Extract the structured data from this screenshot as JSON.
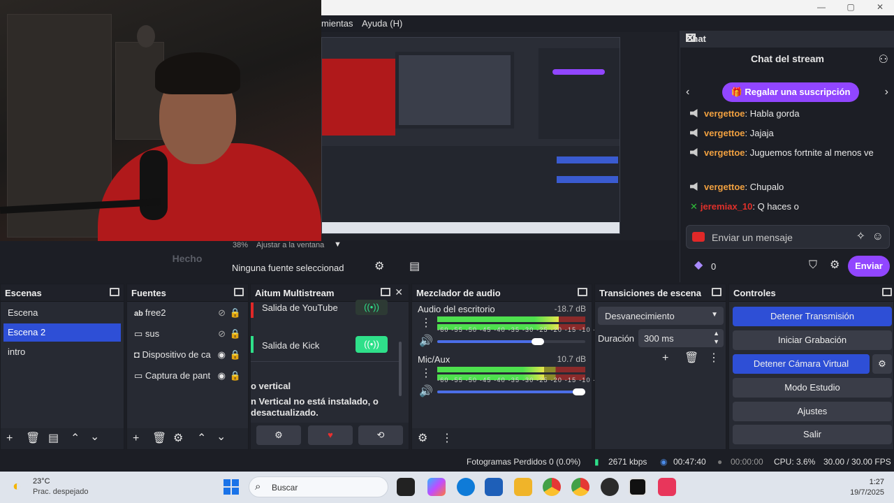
{
  "menu": {
    "tools_partial": "mientas",
    "help": "Ayuda (H)"
  },
  "window_controls": {
    "minimize": "—",
    "maximize": "▢",
    "close": "✕"
  },
  "preview": {
    "zoom": "38%",
    "fit_label": "Ajustar a la ventana"
  },
  "done_button": "Hecho",
  "no_source": "Ninguna fuente seleccionad",
  "chat": {
    "dock_title": "Chat",
    "title": "Chat del stream",
    "gift_button": "Regalar una suscripción",
    "messages": [
      {
        "user": "vergettoe",
        "text": ": Habla gorda"
      },
      {
        "user": "vergettoe",
        "text": ": Jajaja"
      },
      {
        "user": "vergettoe",
        "text": ": Juguemos fortnite al menos ve"
      },
      {
        "user": "vergettoe",
        "text": ": Chupalo"
      },
      {
        "user": "jeremiax_10",
        "text": ": Q haces o"
      }
    ],
    "input_placeholder": "Enviar un mensaje",
    "points": "0",
    "send_button": "Enviar"
  },
  "scenes": {
    "title": "Escenas",
    "items": [
      "Escena",
      "Escena 2",
      "intro"
    ],
    "selected_index": 1
  },
  "sources": {
    "title": "Fuentes",
    "items": [
      {
        "label": "free2",
        "icon": "text-icon"
      },
      {
        "label": "sus",
        "icon": "window-icon"
      },
      {
        "label": "Dispositivo de ca",
        "icon": "camera-icon"
      },
      {
        "label": "Captura de pant",
        "icon": "monitor-icon"
      }
    ]
  },
  "multistream": {
    "title": "Aitum Multistream",
    "outputs": [
      "Salida de YouTube",
      "Salida de Kick"
    ],
    "vertical_heading": "o vertical",
    "vertical_note_1": "n Vertical no está instalado, o",
    "vertical_note_2": "desactualizado."
  },
  "mixer": {
    "title": "Mezclador de audio",
    "ticks": "-60 -55 -50 -45 -40 -35 -30 -25 -20 -15 -10 -5 0",
    "channels": [
      {
        "name": "Audio del escritorio",
        "db": "-18.7 dB",
        "level": 0.82,
        "volume": 0.72
      },
      {
        "name": "Mic/Aux",
        "db": "10.7 dB",
        "level": 0.72,
        "volume": 1.0
      }
    ]
  },
  "transitions": {
    "title": "Transiciones de escena",
    "selected": "Desvanecimiento",
    "duration_label": "Duración",
    "duration_value": "300 ms"
  },
  "controls": {
    "title": "Controles",
    "buttons": [
      "Detener Transmisión",
      "Iniciar Grabación",
      "Detener Cámara Virtual",
      "Modo Estudio",
      "Ajustes",
      "Salir"
    ]
  },
  "status": {
    "dropped": "Fotogramas Perdidos 0 (0.0%)",
    "bitrate": "2671 kbps",
    "live_time": "00:47:40",
    "rec_time": "00:00:00",
    "cpu": "CPU: 3.6%",
    "fps": "30.00 / 30.00 FPS"
  },
  "taskbar": {
    "temp": "23°C",
    "weather": "Prac. despejado",
    "search": "Buscar",
    "time": "1:27",
    "date": "19/7/2025"
  },
  "colors": {
    "accent_blue": "#2e4fd6",
    "twitch_purple": "#9146ff",
    "orange_user": "#f0a040"
  }
}
